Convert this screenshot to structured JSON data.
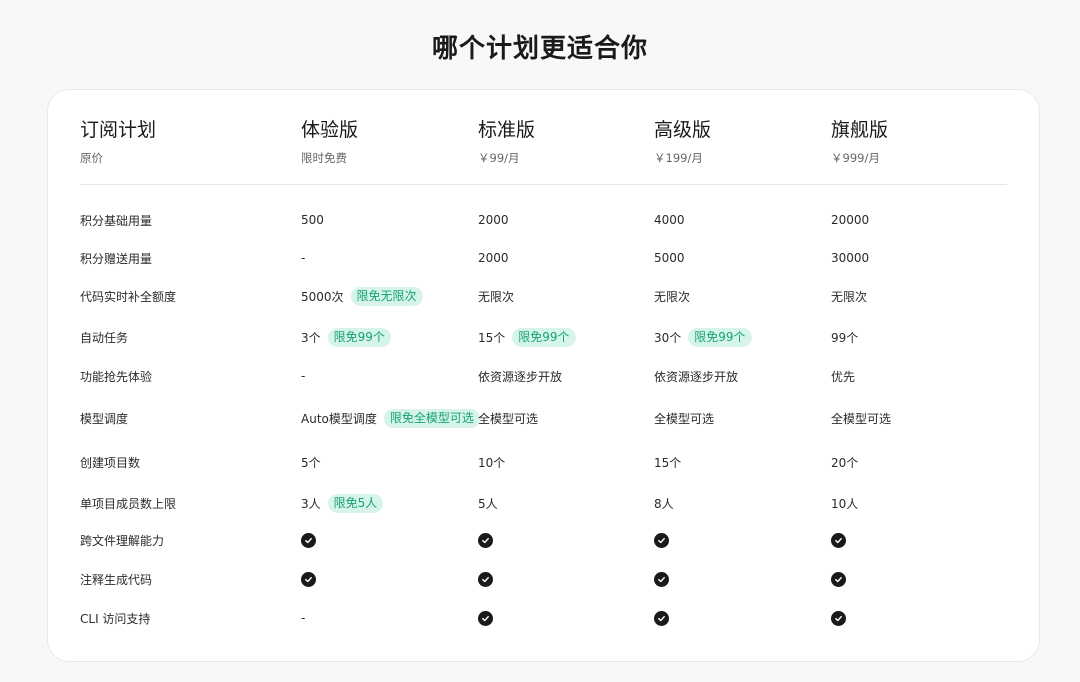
{
  "title": "哪个计划更适合你",
  "header": {
    "label_title": "订阅计划",
    "label_sub": "原价",
    "plans": [
      {
        "name": "体验版",
        "price": "限时免费"
      },
      {
        "name": "标准版",
        "price": "￥99/月"
      },
      {
        "name": "高级版",
        "price": "￥199/月"
      },
      {
        "name": "旗舰版",
        "price": "￥999/月"
      }
    ]
  },
  "rows": [
    {
      "label": "积分基础用量",
      "cells": [
        {
          "text": "500"
        },
        {
          "text": "2000"
        },
        {
          "text": "4000"
        },
        {
          "text": "20000"
        }
      ]
    },
    {
      "label": "积分赠送用量",
      "cells": [
        {
          "text": "-"
        },
        {
          "text": "2000"
        },
        {
          "text": "5000"
        },
        {
          "text": "30000"
        }
      ]
    },
    {
      "label": "代码实时补全额度",
      "cells": [
        {
          "text": "5000次",
          "badge": "限免无限次"
        },
        {
          "text": "无限次"
        },
        {
          "text": "无限次"
        },
        {
          "text": "无限次"
        }
      ]
    },
    {
      "label": "自动任务",
      "cells": [
        {
          "text": "3个",
          "badge": "限免99个"
        },
        {
          "text": "15个",
          "badge": "限免99个"
        },
        {
          "text": "30个",
          "badge": "限免99个"
        },
        {
          "text": "99个"
        }
      ]
    },
    {
      "label": "功能抢先体验",
      "cells": [
        {
          "text": "-"
        },
        {
          "text": "依资源逐步开放"
        },
        {
          "text": "依资源逐步开放"
        },
        {
          "text": "优先"
        }
      ]
    },
    {
      "label": "模型调度",
      "cells": [
        {
          "text": "Auto模型调度",
          "badge": "限免全模型可选"
        },
        {
          "text": "全模型可选"
        },
        {
          "text": "全模型可选"
        },
        {
          "text": "全模型可选"
        }
      ]
    },
    {
      "label": "创建项目数",
      "cells": [
        {
          "text": "5个"
        },
        {
          "text": "10个"
        },
        {
          "text": "15个"
        },
        {
          "text": "20个"
        }
      ]
    },
    {
      "label": "单项目成员数上限",
      "cells": [
        {
          "text": "3人",
          "badge": "限免5人"
        },
        {
          "text": "5人"
        },
        {
          "text": "8人"
        },
        {
          "text": "10人"
        }
      ]
    },
    {
      "label": "跨文件理解能力",
      "cells": [
        {
          "icon": "check-circle-icon"
        },
        {
          "icon": "check-circle-icon"
        },
        {
          "icon": "check-circle-icon"
        },
        {
          "icon": "check-circle-icon"
        }
      ]
    },
    {
      "label": "注释生成代码",
      "cells": [
        {
          "icon": "check-circle-icon"
        },
        {
          "icon": "check-circle-icon"
        },
        {
          "icon": "check-circle-icon"
        },
        {
          "icon": "check-circle-icon"
        }
      ]
    },
    {
      "label": "CLI 访问支持",
      "cells": [
        {
          "text": "-"
        },
        {
          "icon": "check-circle-icon"
        },
        {
          "icon": "check-circle-icon"
        },
        {
          "icon": "check-circle-icon"
        }
      ]
    }
  ],
  "colors": {
    "badge_bg": "#d6f5e8",
    "badge_text": "#17a07a",
    "check": "#1a1a1a"
  }
}
